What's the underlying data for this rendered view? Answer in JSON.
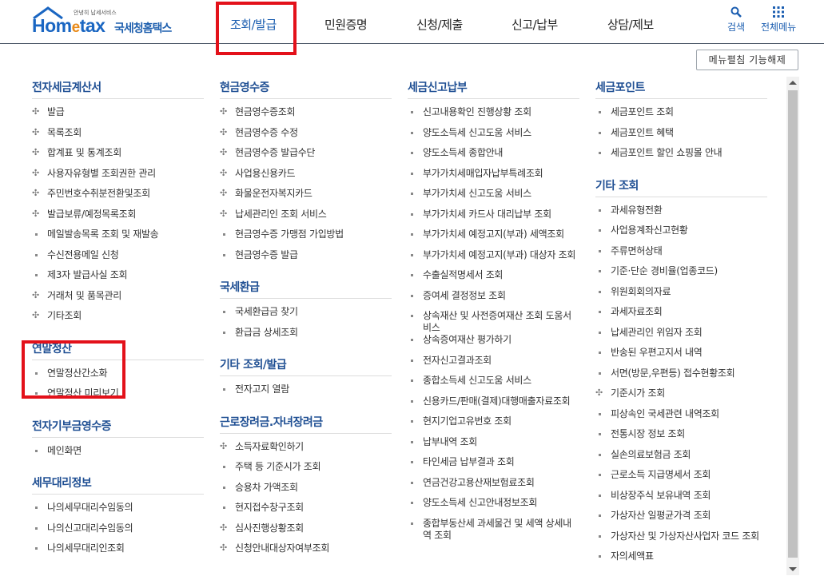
{
  "header": {
    "logo_tagline": "안녕히 납세서비스",
    "logo_brand_a": "Hom",
    "logo_brand_e": "e",
    "logo_brand_b": "tax",
    "logo_korean": "국세청홈택스",
    "nav": [
      "조회/발급",
      "민원증명",
      "신청/제출",
      "신고/납부",
      "상담/제보"
    ],
    "search_label": "검색",
    "allmenu_label": "전체메뉴"
  },
  "fold_button": "메뉴펼침 기능해제",
  "columns": [
    {
      "sections": [
        {
          "title": "전자세금계산서",
          "items": [
            {
              "t": "발급",
              "m": "plus"
            },
            {
              "t": "목록조회",
              "m": "plus"
            },
            {
              "t": "합계표 및 통계조회",
              "m": "plus"
            },
            {
              "t": "사용자유형별 조회권한 관리",
              "m": "plus"
            },
            {
              "t": "주민번호수취분전환및조회",
              "m": "plus"
            },
            {
              "t": "발급보류/예정목록조회",
              "m": "plus"
            },
            {
              "t": "메일발송목록 조회 및 재발송",
              "m": "dot"
            },
            {
              "t": "수신전용메일 신청",
              "m": "dot"
            },
            {
              "t": "제3자 발급사실 조회",
              "m": "dot"
            },
            {
              "t": "거래처 및 품목관리",
              "m": "plus"
            },
            {
              "t": "기타조회",
              "m": "plus"
            }
          ]
        },
        {
          "title": "연말정산",
          "items": [
            {
              "t": "연말정산간소화",
              "m": "dot"
            },
            {
              "t": "연말정산 미리보기",
              "m": "dot"
            }
          ]
        },
        {
          "title": "전자기부금영수증",
          "items": [
            {
              "t": "메인화면",
              "m": "dot"
            }
          ]
        },
        {
          "title": "세무대리정보",
          "items": [
            {
              "t": "나의세무대리수임동의",
              "m": "dot"
            },
            {
              "t": "나의신고대리수임동의",
              "m": "dot"
            },
            {
              "t": "나의세무대리인조회",
              "m": "dot"
            }
          ]
        }
      ]
    },
    {
      "sections": [
        {
          "title": "현금영수증",
          "items": [
            {
              "t": "현금영수증조회",
              "m": "plus"
            },
            {
              "t": "현금영수증 수정",
              "m": "plus"
            },
            {
              "t": "현금영수증 발급수단",
              "m": "plus"
            },
            {
              "t": "사업용신용카드",
              "m": "plus"
            },
            {
              "t": "화물운전자복지카드",
              "m": "plus"
            },
            {
              "t": "납세관리인 조회 서비스",
              "m": "plus"
            },
            {
              "t": "현금영수증 가맹점 가입방법",
              "m": "dot"
            },
            {
              "t": "현금영수증 발급",
              "m": "dot"
            }
          ]
        },
        {
          "title": "국세환급",
          "items": [
            {
              "t": "국세환급금 찾기",
              "m": "dot"
            },
            {
              "t": "환급금 상세조회",
              "m": "dot"
            }
          ]
        },
        {
          "title": "기타 조회/발급",
          "items": [
            {
              "t": "전자고지 열람",
              "m": "dot"
            }
          ]
        },
        {
          "title": "근로장려금.자녀장려금",
          "items": [
            {
              "t": "소득자료확인하기",
              "m": "plus"
            },
            {
              "t": "주택 등 기준시가 조회",
              "m": "dot"
            },
            {
              "t": "승용차 가액조회",
              "m": "dot"
            },
            {
              "t": "현지접수창구조회",
              "m": "dot"
            },
            {
              "t": "심사진행상황조회",
              "m": "plus"
            },
            {
              "t": "신청안내대상자여부조회",
              "m": "plus"
            }
          ]
        }
      ]
    },
    {
      "sections": [
        {
          "title": "세금신고납부",
          "items": [
            {
              "t": "신고내용확인 진행상황 조회",
              "m": "dot"
            },
            {
              "t": "양도소득세 신고도움 서비스",
              "m": "dot"
            },
            {
              "t": "양도소득세 종합안내",
              "m": "dot"
            },
            {
              "t": "부가가치세매입자납부특례조회",
              "m": "dot"
            },
            {
              "t": "부가가치세 신고도움 서비스",
              "m": "dot"
            },
            {
              "t": "부가가치세 카드사 대리납부 조회",
              "m": "dot"
            },
            {
              "t": "부가가치세 예정고지(부과) 세액조회",
              "m": "dot"
            },
            {
              "t": "부가가치세 예정고지(부과) 대상자 조회",
              "m": "dot"
            },
            {
              "t": "수출실적명세서 조회",
              "m": "dot"
            },
            {
              "t": "증여세 결정정보 조회",
              "m": "dot"
            },
            {
              "t": "상속재산 및 사전증여재산 조회 도움서비스",
              "m": "dot"
            },
            {
              "t": "상속증여재산 평가하기",
              "m": "dot"
            },
            {
              "t": "전자신고결과조회",
              "m": "dot"
            },
            {
              "t": "종합소득세 신고도움 서비스",
              "m": "dot"
            },
            {
              "t": "신용카드/판매(결제)대행매출자료조회",
              "m": "dot"
            },
            {
              "t": "현지기업고유번호 조회",
              "m": "dot"
            },
            {
              "t": "납부내역 조회",
              "m": "dot"
            },
            {
              "t": "타인세금 납부결과 조회",
              "m": "dot"
            },
            {
              "t": "연금건강고용산재보험료조회",
              "m": "dot"
            },
            {
              "t": "양도소득세 신고안내정보조회",
              "m": "dot"
            },
            {
              "t": "종합부동산세 과세물건 및 세액 상세내역 조회",
              "m": "dot"
            }
          ]
        }
      ]
    },
    {
      "sections": [
        {
          "title": "세금포인트",
          "items": [
            {
              "t": "세금포인트 조회",
              "m": "dot"
            },
            {
              "t": "세금포인트 혜택",
              "m": "dot"
            },
            {
              "t": "세금포인트 할인 쇼핑몰 안내",
              "m": "dot"
            }
          ]
        },
        {
          "title": "기타 조회",
          "items": [
            {
              "t": "과세유형전환",
              "m": "dot"
            },
            {
              "t": "사업용계좌신고현황",
              "m": "dot"
            },
            {
              "t": "주류면허상태",
              "m": "dot"
            },
            {
              "t": "기준·단순 경비율(업종코드)",
              "m": "dot"
            },
            {
              "t": "위원회회의자료",
              "m": "dot"
            },
            {
              "t": "과세자료조회",
              "m": "dot"
            },
            {
              "t": "납세관리인 위임자 조회",
              "m": "dot"
            },
            {
              "t": "반송된 우편고지서 내역",
              "m": "dot"
            },
            {
              "t": "서면(방문,우편등) 접수현황조회",
              "m": "dot"
            },
            {
              "t": "기준시가 조회",
              "m": "plus"
            },
            {
              "t": "피상속인 국세관련 내역조회",
              "m": "dot"
            },
            {
              "t": "전통시장 정보 조회",
              "m": "dot"
            },
            {
              "t": "실손의료보험금 조회",
              "m": "dot"
            },
            {
              "t": "근로소득 지급명세서 조회",
              "m": "dot"
            },
            {
              "t": "비상장주식 보유내역 조회",
              "m": "dot"
            },
            {
              "t": "가상자산 일평균가격 조회",
              "m": "dot"
            },
            {
              "t": "가상자산 및 가상자산사업자 코드 조회",
              "m": "dot"
            },
            {
              "t": "자의세액표",
              "m": "dot"
            }
          ]
        }
      ]
    }
  ]
}
